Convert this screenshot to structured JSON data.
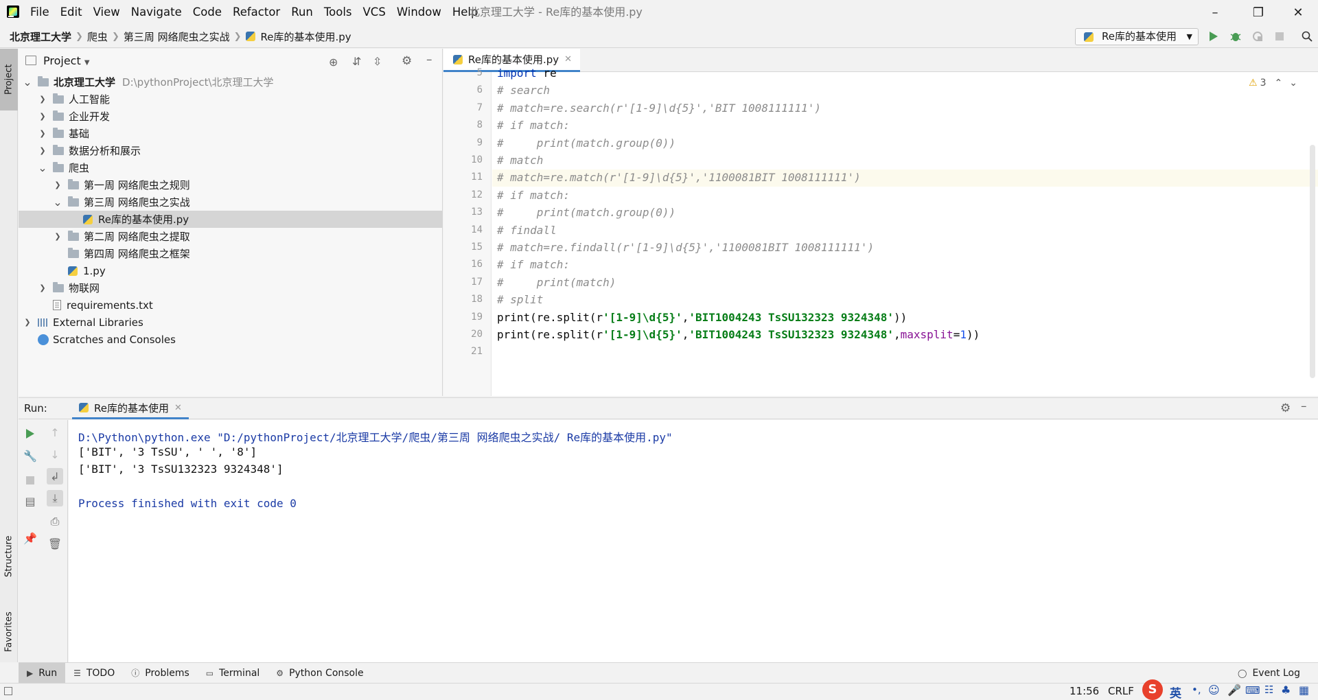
{
  "window": {
    "title": "北京理工大学 - Re库的基本使用.py",
    "minimize_icon": "minimize-icon",
    "maximize_icon": "restore-icon",
    "close_icon": "close-icon"
  },
  "menu": [
    "File",
    "Edit",
    "View",
    "Navigate",
    "Code",
    "Refactor",
    "Run",
    "Tools",
    "VCS",
    "Window",
    "Help"
  ],
  "breadcrumb": [
    "北京理工大学",
    "爬虫",
    "第三周 网络爬虫之实战",
    "Re库的基本使用.py"
  ],
  "run_config": {
    "label": "Re库的基本使用"
  },
  "left_strip": {
    "project": "Project",
    "structure": "Structure",
    "favorites": "Favorites"
  },
  "project_panel": {
    "title": "Project",
    "tree": [
      {
        "label": "北京理工大学",
        "hint": "D:\\pythonProject\\北京理工大学",
        "type": "folder",
        "expanded": true
      },
      {
        "label": "人工智能",
        "type": "folder"
      },
      {
        "label": "企业开发",
        "type": "folder"
      },
      {
        "label": "基础",
        "type": "folder"
      },
      {
        "label": "数据分析和展示",
        "type": "folder"
      },
      {
        "label": "爬虫",
        "type": "folder",
        "expanded": true
      },
      {
        "label": "第一周 网络爬虫之规则",
        "type": "folder"
      },
      {
        "label": "第三周 网络爬虫之实战",
        "type": "folder",
        "expanded": true
      },
      {
        "label": "Re库的基本使用.py",
        "type": "python",
        "selected": true
      },
      {
        "label": "第二周 网络爬虫之提取",
        "type": "folder"
      },
      {
        "label": "第四周 网络爬虫之框架",
        "type": "folder"
      },
      {
        "label": "1.py",
        "type": "python"
      },
      {
        "label": "物联网",
        "type": "folder"
      },
      {
        "label": "requirements.txt",
        "type": "text"
      },
      {
        "label": "External Libraries",
        "type": "library"
      },
      {
        "label": "Scratches and Consoles",
        "type": "scratch"
      }
    ]
  },
  "editor": {
    "tab_label": "Re库的基本使用.py",
    "warnings_count": "3",
    "current_line": "11",
    "lines": [
      {
        "n": "5",
        "t": "import re"
      },
      {
        "n": "6",
        "t": "# search"
      },
      {
        "n": "7",
        "t": "# match=re.search(r'[1-9]\\d{5}','BIT 1008111111')"
      },
      {
        "n": "8",
        "t": "# if match:"
      },
      {
        "n": "9",
        "t": "#     print(match.group(0))"
      },
      {
        "n": "10",
        "t": "# match"
      },
      {
        "n": "11",
        "t": "# match=re.match(r'[1-9]\\d{5}','1100081BIT 1008111111')"
      },
      {
        "n": "12",
        "t": "# if match:"
      },
      {
        "n": "13",
        "t": "#     print(match.group(0))"
      },
      {
        "n": "14",
        "t": "# findall"
      },
      {
        "n": "15",
        "t": "# match=re.findall(r'[1-9]\\d{5}','1100081BIT 1008111111')"
      },
      {
        "n": "16",
        "t": "# if match:"
      },
      {
        "n": "17",
        "t": "#     print(match)"
      },
      {
        "n": "18",
        "t": "# split"
      },
      {
        "n": "19",
        "t": "print(re.split(r'[1-9]\\d{5}','BIT1004243 TsSU132323 9324348'))"
      },
      {
        "n": "20",
        "t": "print(re.split(r'[1-9]\\d{5}','BIT1004243 TsSU132323 9324348',maxsplit=1))"
      },
      {
        "n": "21",
        "t": ""
      }
    ]
  },
  "run_panel": {
    "label": "Run:",
    "tab_label": "Re库的基本使用",
    "console": [
      "D:\\Python\\python.exe \"D:/pythonProject/北京理工大学/爬虫/第三周 网络爬虫之实战/ Re库的基本使用.py\"",
      "['BIT', '3 TsSU', ' ', '8']",
      "['BIT', '3 TsSU132323 9324348']",
      "",
      "Process finished with exit code 0"
    ]
  },
  "bottom_tabs": [
    "Run",
    "TODO",
    "Problems",
    "Terminal",
    "Python Console"
  ],
  "event_log": "Event Log",
  "status": {
    "position": "11:56",
    "line_sep": "CRLF",
    "ime": "英"
  },
  "colors": {
    "accent": "#4083c9",
    "run_green": "#499c54",
    "comment": "#8c8c8c",
    "string": "#067d17"
  }
}
